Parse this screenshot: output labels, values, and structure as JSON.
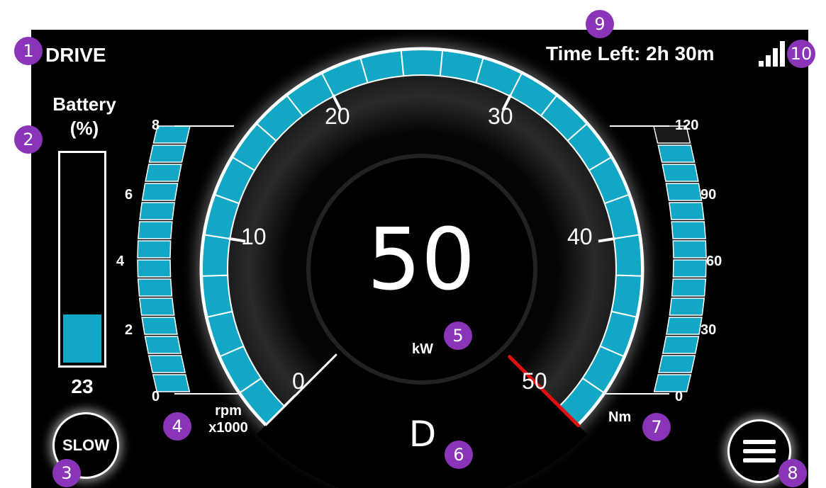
{
  "mode": "DRIVE",
  "time_left": "Time Left: 2h 30m",
  "signal": {
    "icon": "signal-bars-icon",
    "bars": 4
  },
  "battery": {
    "label_line1": "Battery",
    "label_line2": "(%)",
    "value": "23",
    "percent": 23
  },
  "rpm": {
    "unit_line1": "rpm",
    "unit_line2": "x1000",
    "ticks": [
      "0",
      "2",
      "4",
      "6",
      "8"
    ],
    "level_fraction": 1.0
  },
  "power": {
    "value": "50",
    "unit": "kW",
    "ticks": [
      "0",
      "10",
      "20",
      "30",
      "40",
      "50"
    ],
    "needle_value": 50
  },
  "torque": {
    "unit": "Nm",
    "ticks": [
      "0",
      "30",
      "60",
      "90",
      "120"
    ],
    "level_fraction": 0.92
  },
  "gear": "D",
  "slow_button": {
    "label": "SLOW"
  },
  "menu_button": {
    "icon": "hamburger-menu-icon"
  },
  "callouts": [
    "1",
    "2",
    "3",
    "4",
    "5",
    "6",
    "7",
    "8",
    "9",
    "10"
  ],
  "colors": {
    "accent": "#12a7c4",
    "needle": "#e01010",
    "callout": "#8a35b8",
    "background": "#000000"
  }
}
